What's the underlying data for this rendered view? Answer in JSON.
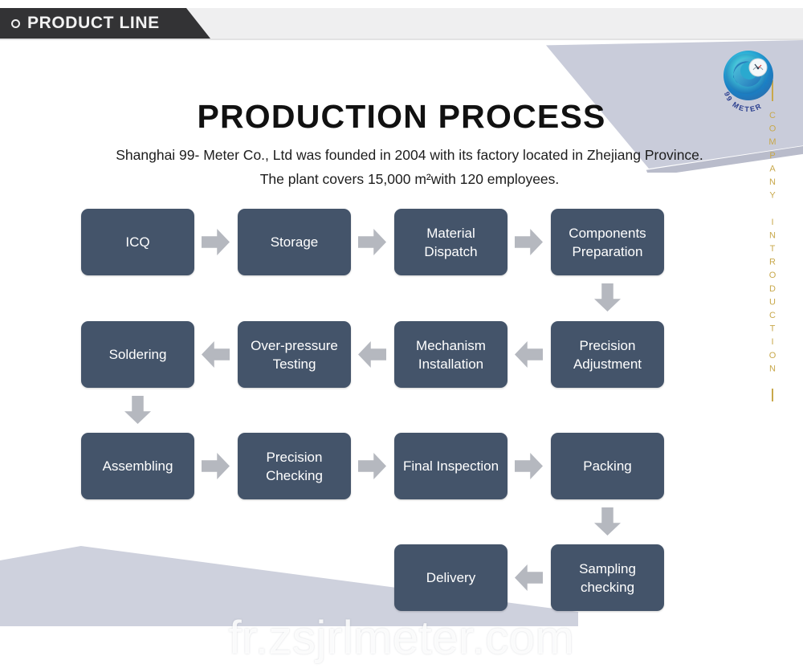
{
  "header": {
    "tab_label": "PRODUCT LINE",
    "bullet_icon": "circle-outline-icon"
  },
  "branding": {
    "logo_icon": "99-meter-spiral-logo-icon",
    "logo_text": "99 METER",
    "vertical_text": "COMPANY INTRODUCTION",
    "gold_color": "#c8a84b"
  },
  "title": "PRODUCTION PROCESS",
  "subtitle": "Shanghai 99- Meter Co., Ltd was founded in 2004 with its factory located in Zhejiang Province. The plant covers 15,000 m²with 120 employees.",
  "colors": {
    "node_fill": "#44546a",
    "arrow_fill": "#b5b8bf",
    "header_tab": "#333335",
    "header_band": "#efeff0",
    "deco_shape": "#ced1dd"
  },
  "flow": {
    "nodes": [
      {
        "id": "icq",
        "label": "ICQ",
        "row": 1,
        "col": 1
      },
      {
        "id": "storage",
        "label": "Storage",
        "row": 1,
        "col": 2
      },
      {
        "id": "material-dispatch",
        "label": "Material Dispatch",
        "row": 1,
        "col": 3
      },
      {
        "id": "components-preparation",
        "label": "Components Preparation",
        "row": 1,
        "col": 4
      },
      {
        "id": "soldering",
        "label": "Soldering",
        "row": 2,
        "col": 1
      },
      {
        "id": "over-pressure-testing",
        "label": "Over-pressure Testing",
        "row": 2,
        "col": 2
      },
      {
        "id": "mechanism-installation",
        "label": "Mechanism Installation",
        "row": 2,
        "col": 3
      },
      {
        "id": "precision-adjustment",
        "label": "Precision Adjustment",
        "row": 2,
        "col": 4
      },
      {
        "id": "assembling",
        "label": "Assembling",
        "row": 3,
        "col": 1
      },
      {
        "id": "precision-checking",
        "label": "Precision Checking",
        "row": 3,
        "col": 2
      },
      {
        "id": "final-inspection",
        "label": "Final Inspection",
        "row": 3,
        "col": 3
      },
      {
        "id": "packing",
        "label": "Packing",
        "row": 3,
        "col": 4
      },
      {
        "id": "delivery",
        "label": "Delivery",
        "row": 4,
        "col": 3
      },
      {
        "id": "sampling-checking",
        "label": "Sampling checking",
        "row": 4,
        "col": 4
      }
    ],
    "arrows": [
      {
        "from": "icq",
        "to": "storage",
        "direction": "right"
      },
      {
        "from": "storage",
        "to": "material-dispatch",
        "direction": "right"
      },
      {
        "from": "material-dispatch",
        "to": "components-preparation",
        "direction": "right"
      },
      {
        "from": "components-preparation",
        "to": "precision-adjustment",
        "direction": "down"
      },
      {
        "from": "precision-adjustment",
        "to": "mechanism-installation",
        "direction": "left"
      },
      {
        "from": "mechanism-installation",
        "to": "over-pressure-testing",
        "direction": "left"
      },
      {
        "from": "over-pressure-testing",
        "to": "soldering",
        "direction": "left"
      },
      {
        "from": "soldering",
        "to": "assembling",
        "direction": "down"
      },
      {
        "from": "assembling",
        "to": "precision-checking",
        "direction": "right"
      },
      {
        "from": "precision-checking",
        "to": "final-inspection",
        "direction": "right"
      },
      {
        "from": "final-inspection",
        "to": "packing",
        "direction": "right"
      },
      {
        "from": "packing",
        "to": "sampling-checking",
        "direction": "down"
      },
      {
        "from": "sampling-checking",
        "to": "delivery",
        "direction": "left"
      }
    ]
  },
  "watermark": "fr.zsjrlmeter.com"
}
